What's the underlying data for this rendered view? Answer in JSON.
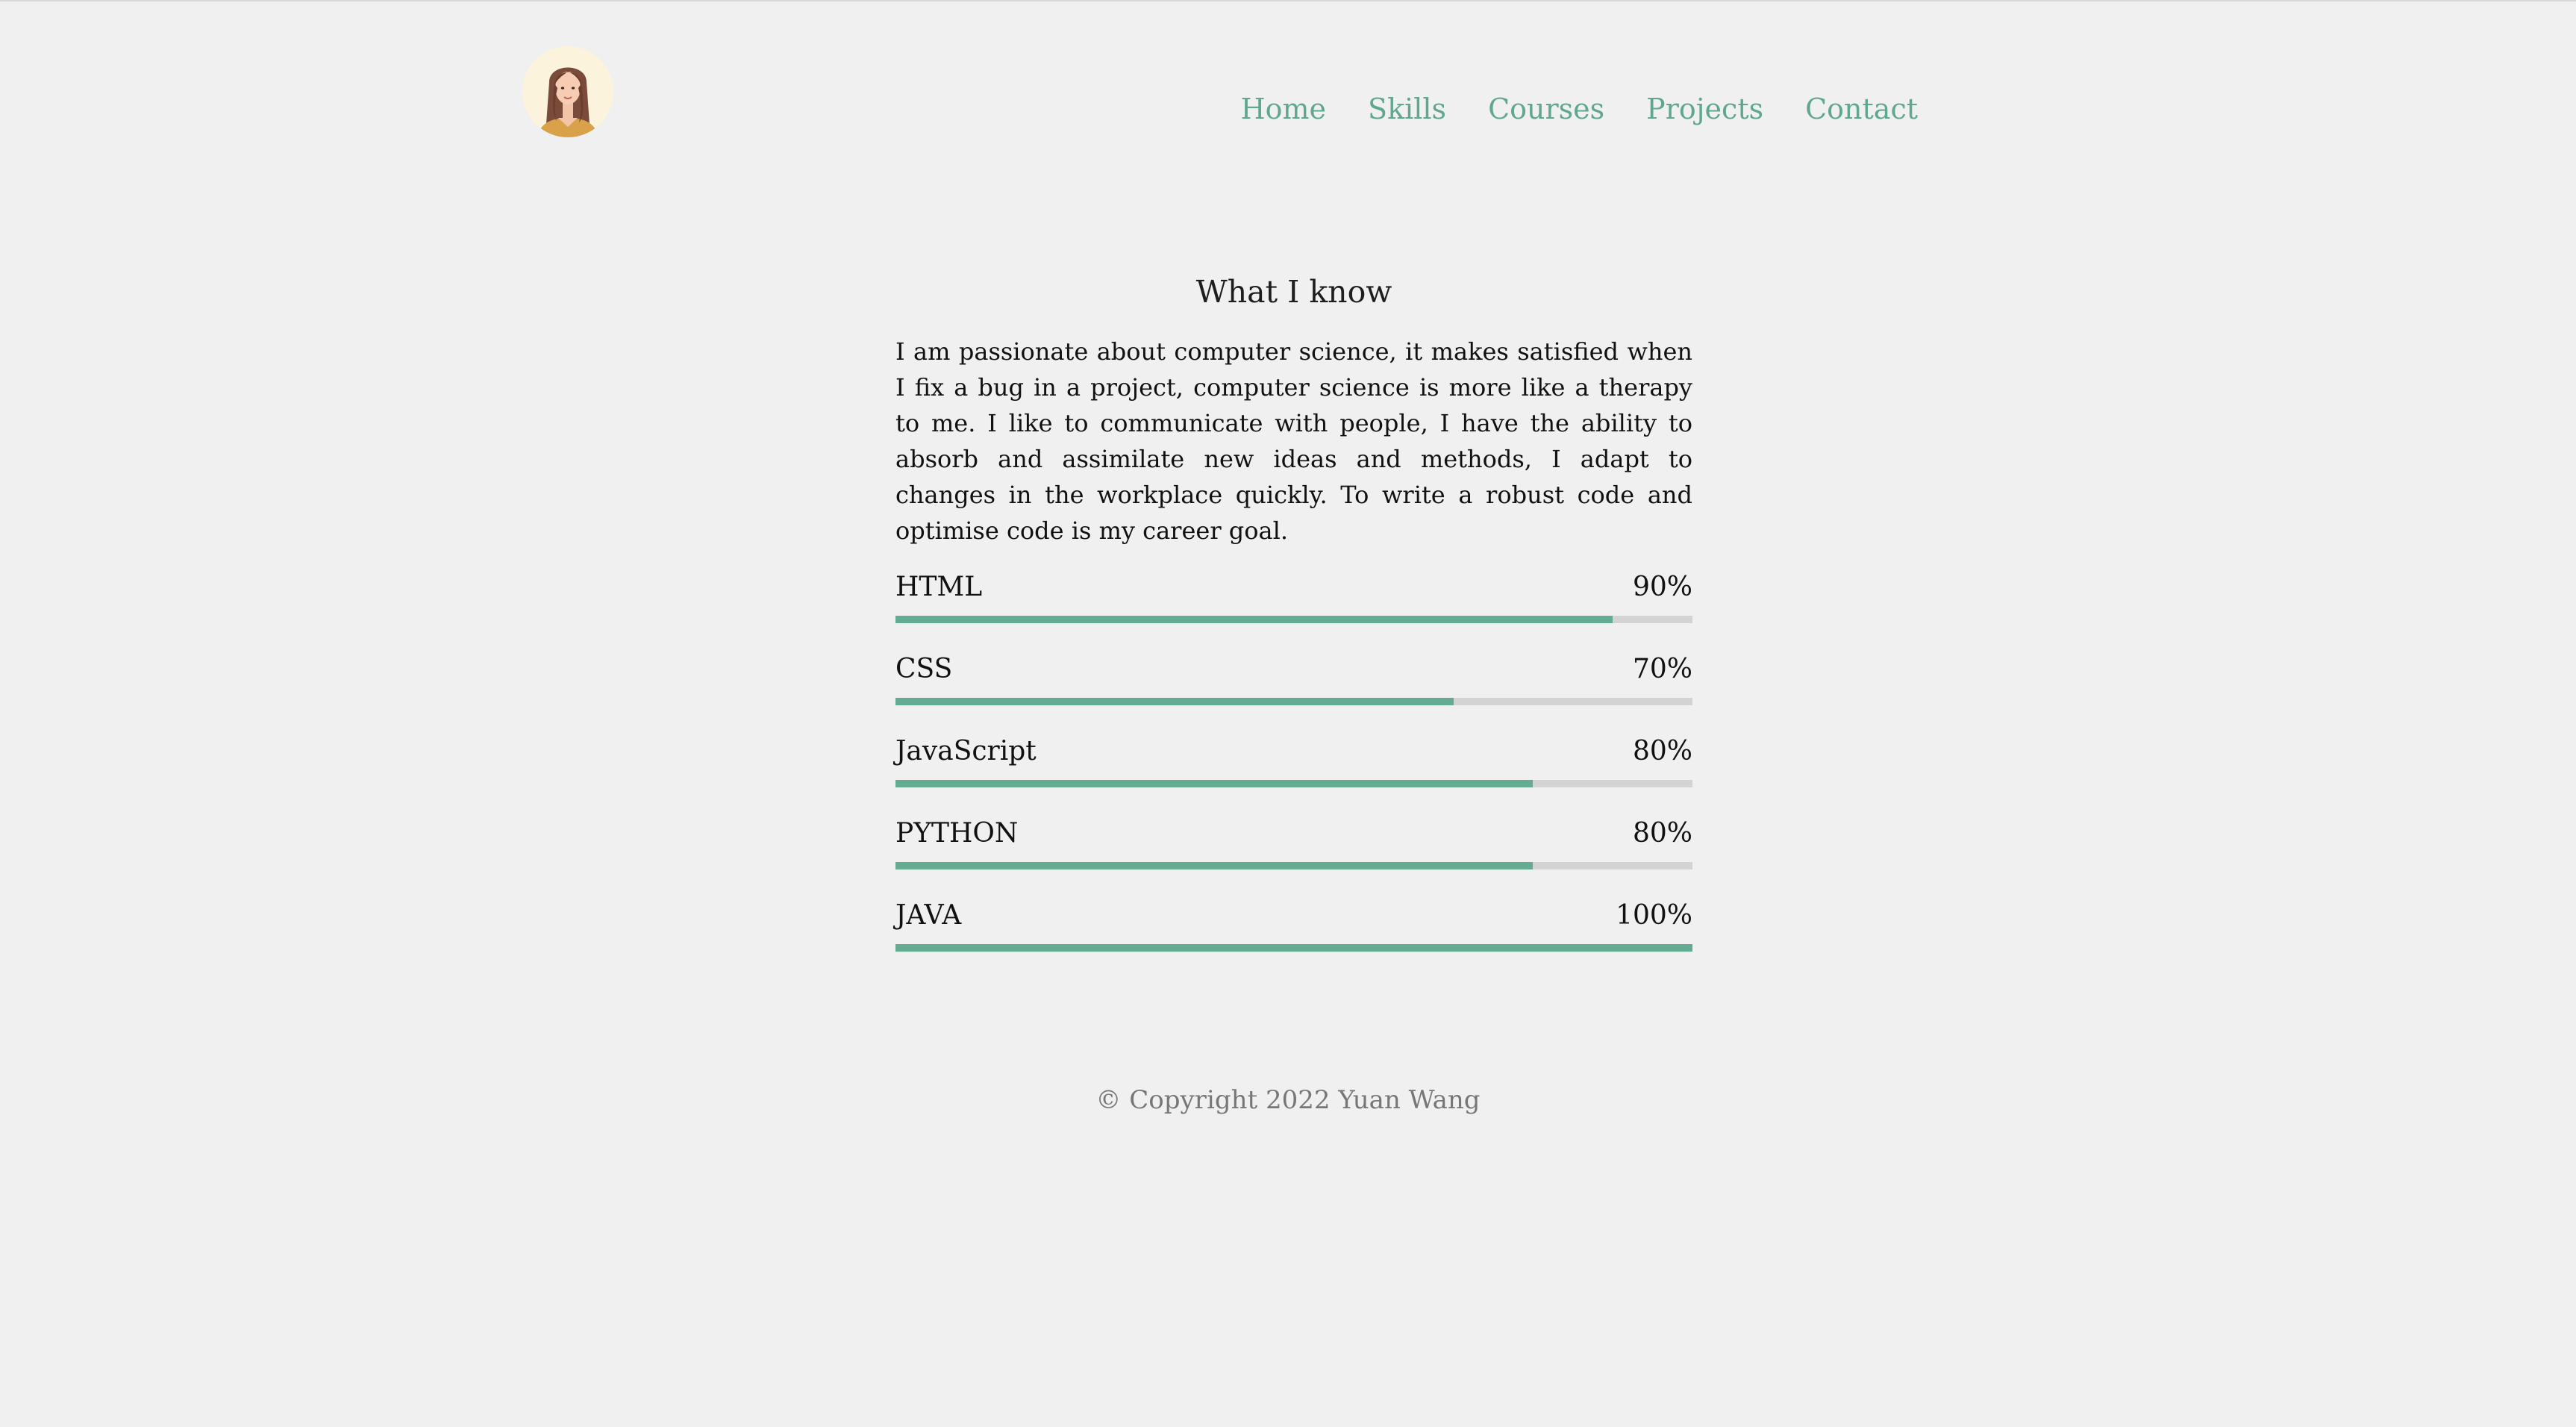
{
  "nav": {
    "links": [
      "Home",
      "Skills",
      "Courses",
      "Projects",
      "Contact"
    ]
  },
  "main": {
    "title": "What I know",
    "intro": "I am passionate about computer science, it makes satisfied when I fix a bug in a project, computer science is more like a therapy to me. I like to communicate with people, I have the ability to absorb and assimilate new ideas and methods, I adapt to changes in the workplace quickly. To write a robust code and optimise code is my career goal."
  },
  "skills": [
    {
      "name": "HTML",
      "percent_label": "90%",
      "level": 90
    },
    {
      "name": "CSS",
      "percent_label": "70%",
      "level": 70
    },
    {
      "name": "JavaScript",
      "percent_label": "80%",
      "level": 80
    },
    {
      "name": "PYTHON",
      "percent_label": "80%",
      "level": 80
    },
    {
      "name": "JAVA",
      "percent_label": "100%",
      "level": 100
    }
  ],
  "footer": {
    "copyright": "© Copyright 2022 Yuan Wang"
  },
  "colors": {
    "accent": "#5fa88f",
    "bar_fill": "#63ab91",
    "bar_track": "#d3d3d3",
    "background": "#f0f0f0"
  },
  "icons": {
    "avatar": "woman-portrait-avatar"
  }
}
